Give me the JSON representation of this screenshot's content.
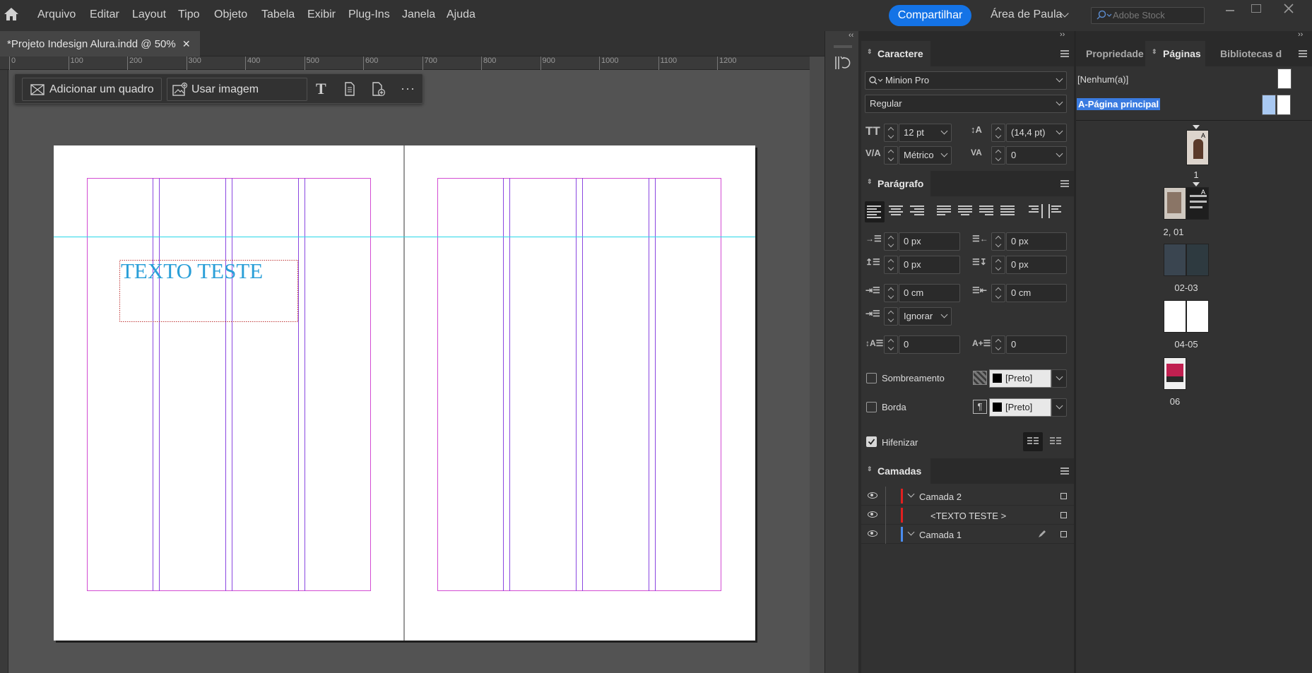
{
  "menubar": {
    "items": [
      "Arquivo",
      "Editar",
      "Layout",
      "Tipo",
      "Objeto",
      "Tabela",
      "Exibir",
      "Plug-Ins",
      "Janela",
      "Ajuda"
    ],
    "share_label": "Compartilhar",
    "workspace": "Área de Paula",
    "search_placeholder": "Adobe Stock"
  },
  "document": {
    "tab_title": "*Projeto Indesign Alura.indd @ 50%",
    "ruler_labels": [
      "0",
      "100",
      "200",
      "300",
      "400",
      "500",
      "600",
      "700",
      "800",
      "900",
      "1000",
      "1100",
      "1200"
    ],
    "text_frame": "TEXTO TESTE"
  },
  "context_toolbar": {
    "add_frame": "Adicionar um quadro",
    "use_image": "Usar imagem"
  },
  "character": {
    "tab": "Caractere",
    "font": "Minion Pro",
    "style": "Regular",
    "size": "12 pt",
    "leading": "(14,4 pt)",
    "kerning": "Métrico",
    "tracking": "0"
  },
  "paragraph": {
    "tab": "Parágrafo",
    "left_indent": "0 px",
    "right_indent": "0 px",
    "space_before": "0 px",
    "space_after": "0 px",
    "first_line": "0 cm",
    "last_line": "0 cm",
    "align_to_grid": "Ignorar",
    "dropcap_lines": "0",
    "dropcap_chars": "0",
    "shading_label": "Sombreamento",
    "shading_color": "[Preto]",
    "border_label": "Borda",
    "border_color": "[Preto]",
    "hyphenate_label": "Hifenizar",
    "hyphenate_checked": true
  },
  "layers": {
    "tab": "Camadas",
    "rows": [
      {
        "name": "Camada 2",
        "color": "#e02020"
      },
      {
        "name": "<TEXTO TESTE >",
        "color": "#e02020"
      },
      {
        "name": "Camada 1",
        "color": "#4a8cf0"
      }
    ]
  },
  "right_panel": {
    "tabs": [
      "Propriedade",
      "Páginas",
      "Bibliotecas d"
    ],
    "active_tab": "Páginas",
    "none_master": "[Nenhum(a)]",
    "master": "A-Página principal",
    "pages": [
      "1",
      "2, 01",
      "02-03",
      "04-05",
      "06"
    ]
  },
  "colors": {
    "accent": "#1473e6",
    "margin_guide": "#d24bd2",
    "ruler_guide": "#27d6e8",
    "text_color": "#2a9fd8"
  }
}
